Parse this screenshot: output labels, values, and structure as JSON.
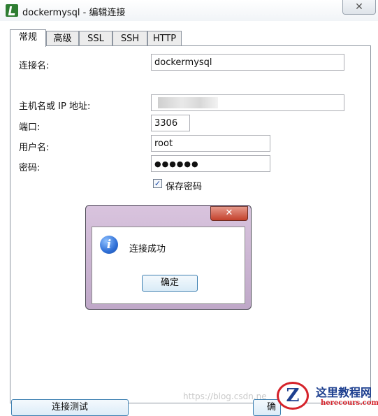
{
  "window": {
    "title": "dockermysql - 编辑连接",
    "close_symbol": "✕",
    "icon": "navicat-app-icon"
  },
  "tabs": [
    {
      "label": "常规",
      "active": true
    },
    {
      "label": "高级",
      "active": false
    },
    {
      "label": "SSL",
      "active": false
    },
    {
      "label": "SSH",
      "active": false
    },
    {
      "label": "HTTP",
      "active": false
    }
  ],
  "form": {
    "connection_name_label": "连接名:",
    "connection_name_value": "dockermysql",
    "host_label": "主机名或 IP 地址:",
    "host_value": "",
    "port_label": "端口:",
    "port_value": "3306",
    "username_label": "用户名:",
    "username_value": "root",
    "password_label": "密码:",
    "password_value": "●●●●●●",
    "save_password_label": "保存密码",
    "save_password_checked": true
  },
  "dialog": {
    "message": "连接成功",
    "ok_label": "确定",
    "close_symbol": "✕",
    "icon": "info-icon"
  },
  "bottom": {
    "test_button_label": "连接测试",
    "right_button_partial": "确"
  },
  "watermark": {
    "text": "https://blog.csdn.ne",
    "logo_letter": "Z",
    "logo_title": "这里教程网",
    "logo_subtitle": "herecours.com"
  },
  "colors": {
    "dialog_frame": "#c9b2d1",
    "close_red": "#c3412c",
    "logo_red": "#d5232b",
    "logo_blue": "#1d3f8f"
  }
}
